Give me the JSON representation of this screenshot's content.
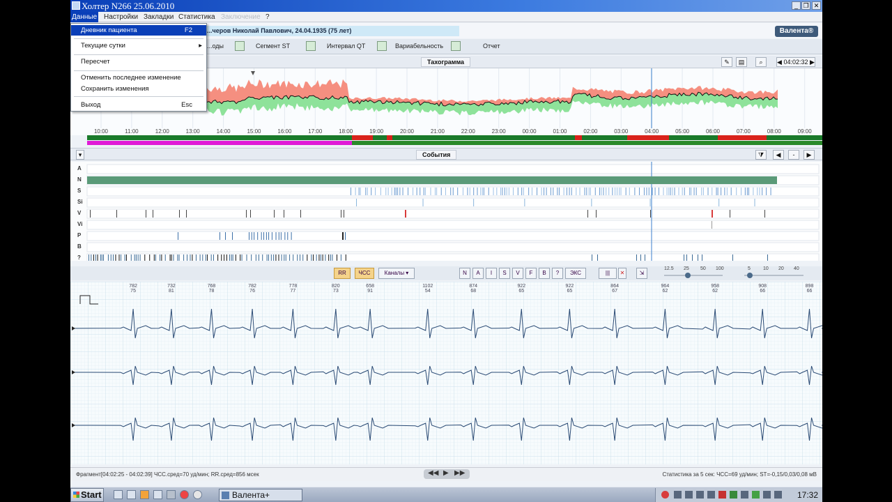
{
  "window": {
    "title": "Холтер  N266  25.06.2010",
    "buttons": {
      "minimize": "_",
      "restore": "❐",
      "close": "✕"
    }
  },
  "menubar": {
    "items": [
      {
        "label": "Данные",
        "active": true
      },
      {
        "label": "Настройки"
      },
      {
        "label": "Закладки"
      },
      {
        "label": "Статистика"
      },
      {
        "label": "Заключение",
        "disabled": true
      },
      {
        "label": "?"
      }
    ]
  },
  "dropdown": {
    "items": [
      {
        "label": "Дневник пациента",
        "shortcut": "F2",
        "selected": true
      },
      {
        "label": "Текущие сутки",
        "submenu": "▸"
      },
      {
        "label": "Пересчет"
      },
      {
        "label": "Отменить последнее изменение"
      },
      {
        "label": "Сохранить изменения"
      },
      {
        "label": "Выход",
        "shortcut": "Esc"
      }
    ]
  },
  "patient": {
    "name": "...черов Николай Павлович, 24.04.1935 (75 лет)"
  },
  "brand": {
    "label": "Валента®"
  },
  "toolbar": {
    "items": [
      "...оды",
      "Сегмент ST",
      "Интервал QT",
      "Вариабельность",
      "Отчет"
    ]
  },
  "tachogram": {
    "tab": "Тахограмма",
    "time": "04:02:32",
    "axis_labels": [
      "10:00",
      "11:00",
      "12:00",
      "13:00",
      "14:00",
      "15:00",
      "16:00",
      "17:00",
      "18:00",
      "19:00",
      "20:00",
      "21:00",
      "22:00",
      "23:00",
      "00:00",
      "01:00",
      "02:00",
      "03:00",
      "04:00",
      "05:00",
      "06:00",
      "07:00",
      "08:00",
      "09:00"
    ],
    "colors": {
      "max": "#f58f80",
      "min": "#8ee29a",
      "mean": "#111111",
      "cursor": "#3b7fcc"
    }
  },
  "events": {
    "tab": "События",
    "rows": [
      "A",
      "N",
      "S",
      "Si",
      "V",
      "Vi",
      "P",
      "B",
      "?"
    ]
  },
  "ecg_toolbar": {
    "rr": "RR",
    "hr": "ЧСС",
    "channels": "Каналы",
    "rhythm_buttons": [
      "N",
      "A",
      "I",
      "S",
      "V",
      "F",
      "B",
      "?",
      "ЭКС"
    ],
    "gain_labels": [
      "12.5",
      "25",
      "50",
      "100"
    ],
    "speed_labels": [
      "5",
      "10",
      "20",
      "40"
    ]
  },
  "ecg": {
    "beats": [
      {
        "rr": "782",
        "hr": "75"
      },
      {
        "rr": "732",
        "hr": "81"
      },
      {
        "rr": "768",
        "hr": "78"
      },
      {
        "rr": "782",
        "hr": "76"
      },
      {
        "rr": "778",
        "hr": "77"
      },
      {
        "rr": "820",
        "hr": "73"
      },
      {
        "rr": "658",
        "hr": "91"
      },
      {
        "rr": "1102",
        "hr": "54"
      },
      {
        "rr": "874",
        "hr": "68"
      },
      {
        "rr": "922",
        "hr": "65"
      },
      {
        "rr": "922",
        "hr": "65"
      },
      {
        "rr": "864",
        "hr": "67"
      },
      {
        "rr": "964",
        "hr": "62"
      },
      {
        "rr": "958",
        "hr": "62"
      },
      {
        "rr": "908",
        "hr": "66"
      },
      {
        "rr": "898",
        "hr": "66"
      }
    ]
  },
  "statusbar": {
    "left": "Фрагмент[04:02:25 - 04:02:39]  ЧСС.сред=70 уд/мин;  RR.сред=856 мсек",
    "right": "Статистика за 5 сек:  ЧСС=69 уд/мин; ST=-0,15/0,03/0,08 мВ"
  },
  "taskbar": {
    "start": "Start",
    "task": "Валента+",
    "clock": "17:32"
  }
}
